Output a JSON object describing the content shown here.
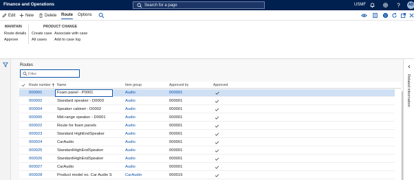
{
  "app": {
    "title": "Finance and Operations",
    "search_placeholder": "Search for a page",
    "company": "USMF",
    "avatar": "AD"
  },
  "actions": {
    "edit": "Edit",
    "new": "New",
    "delete": "Delete",
    "route": "Route",
    "options": "Options"
  },
  "ribbon": {
    "maintain": {
      "title": "MAINTAIN",
      "items": [
        "Route details",
        "Approve"
      ]
    },
    "product_change": {
      "title": "PRODUCT CHANGE",
      "col1": [
        "Create case",
        "All cases"
      ],
      "col2": [
        "Associate with case",
        "Add to case log"
      ]
    }
  },
  "page": {
    "heading": "Routes",
    "filter_placeholder": "Filter"
  },
  "grid": {
    "columns": [
      "Route number",
      "Name",
      "Item group",
      "Approved by",
      "Approved"
    ],
    "rows": [
      {
        "number": "000001",
        "name": "Foam panel - P0001",
        "group": "Audio",
        "approved_by": "000001"
      },
      {
        "number": "000002",
        "name": "Standard speaker - D0003",
        "group": "Audio",
        "approved_by": "000001"
      },
      {
        "number": "000004",
        "name": "Speaker cabinet - D0002",
        "group": "Audio",
        "approved_by": "000001"
      },
      {
        "number": "000005",
        "name": "Mid-range speaker - D0001",
        "group": "Audio",
        "approved_by": "000001"
      },
      {
        "number": "000022",
        "name": "Route for foam panels",
        "group": "Audio",
        "approved_by": "000001"
      },
      {
        "number": "000023",
        "name": "Standard HighEndSpeaker",
        "group": "Audio",
        "approved_by": "000001"
      },
      {
        "number": "000024",
        "name": "CarAudio",
        "group": "Audio",
        "approved_by": "000001"
      },
      {
        "number": "000025",
        "name": "StandardHighEndSpeaker",
        "group": "Audio",
        "approved_by": "000001"
      },
      {
        "number": "000026",
        "name": "StandardHighEndSpeaker",
        "group": "Audio",
        "approved_by": "000001"
      },
      {
        "number": "000027",
        "name": "CarAudio",
        "group": "Audio",
        "approved_by": "000001"
      },
      {
        "number": "000028",
        "name": "Product model no. Car Audio Sy...",
        "group": "CarAudio",
        "approved_by": "000019"
      }
    ]
  },
  "right_pane": {
    "label": "Related information"
  },
  "colors": {
    "nav": "#002050",
    "accent": "#0b53a8",
    "selected": "#cfe0f5"
  }
}
